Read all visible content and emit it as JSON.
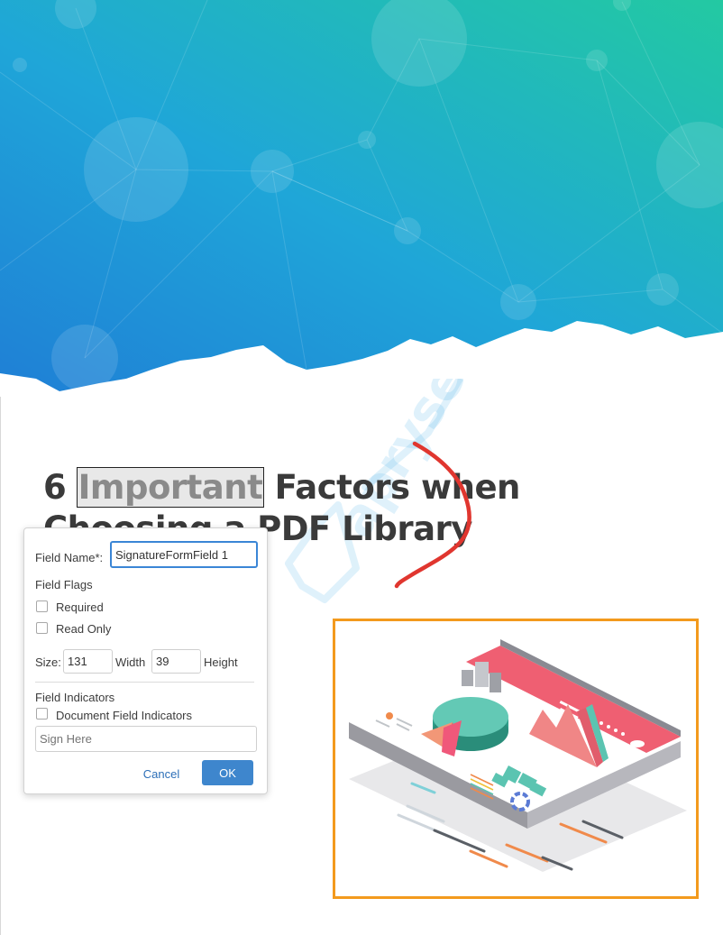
{
  "document": {
    "title_prefix": "6 ",
    "title_highlight": "Important",
    "title_rest": " Factors when",
    "title_line2": "Choosing a PDF Library",
    "watermark_text": "apryse"
  },
  "field_dialog": {
    "field_name_label": "Field Name*:",
    "field_name_value": "SignatureFormField 1",
    "flags_heading": "Field Flags",
    "required_label": "Required",
    "readonly_label": "Read Only",
    "size_label": "Size:",
    "width_value": "131",
    "width_label": "Width",
    "height_value": "39",
    "height_label": "Height",
    "indicators_heading": "Field Indicators",
    "doc_indicators_label": "Document Field Indicators",
    "sign_here_placeholder": "Sign Here",
    "cancel_label": "Cancel",
    "ok_label": "OK",
    "required_checked": false,
    "readonly_checked": false,
    "doc_indicators_checked": false
  },
  "colors": {
    "hero_gradient_start": "#1f93d9",
    "hero_gradient_end": "#22c6a0",
    "ink_annotation": "#e0362f",
    "image_border": "#f39a1d",
    "ok_button": "#3e86cd"
  }
}
